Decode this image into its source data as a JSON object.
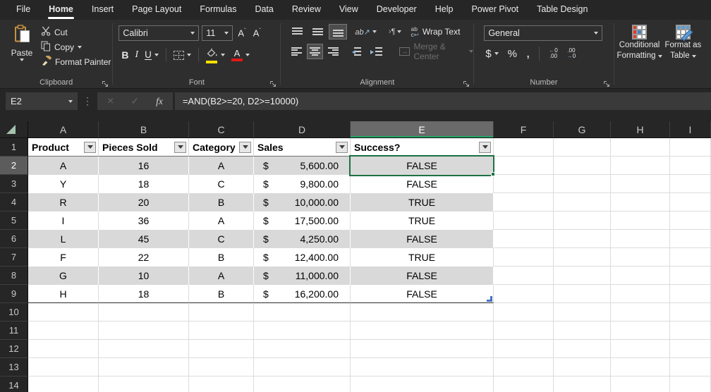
{
  "tabs": {
    "items": [
      "File",
      "Home",
      "Insert",
      "Page Layout",
      "Formulas",
      "Data",
      "Review",
      "View",
      "Developer",
      "Help",
      "Power Pivot",
      "Table Design"
    ],
    "active": "Home"
  },
  "ribbon": {
    "clipboard": {
      "group_label": "Clipboard",
      "paste": "Paste",
      "cut": "Cut",
      "copy": "Copy",
      "format_painter": "Format Painter"
    },
    "font": {
      "group_label": "Font",
      "font_name": "Calibri",
      "font_size": "11",
      "bold": "B",
      "italic": "I",
      "underline": "U"
    },
    "alignment": {
      "group_label": "Alignment",
      "wrap_text": "Wrap Text",
      "merge_center": "Merge & Center"
    },
    "number": {
      "group_label": "Number",
      "number_format": "General",
      "currency": "$",
      "percent": "%",
      "comma": ",",
      "decimals": ".00",
      "zero": "0",
      "arrow_left": "←",
      "arrow_right": "→"
    },
    "styles": {
      "conditional_formatting_line1": "Conditional",
      "conditional_formatting_line2": "Formatting",
      "format_as_table_line1": "Format as",
      "format_as_table_line2": "Table"
    }
  },
  "formula_bar": {
    "name_box": "E2",
    "cancel": "×",
    "enter": "✓",
    "insert_function": "fx",
    "more_dots": "⋮",
    "formula": "=AND(B2>=20, D2>=10000)"
  },
  "icons": {
    "orientation_text": "ab",
    "orientation_arrow": "↗",
    "pilcrow": "¶",
    "direction_mark": "›",
    "wrap_top": "ab",
    "wrap_bottom": "c",
    "return_arrow": "↩",
    "merge_arrow": "↔",
    "size_up_letter": "A",
    "size_up_caret": "ˆ",
    "size_down_letter": "A",
    "size_down_caret": "ˇ",
    "font_color_letter": "A"
  },
  "colors": {
    "accent_green": "#21a366",
    "selection_border_green": "#1e7145",
    "band_gray": "#d9d9d9",
    "fill_color_yellow": "#f7e000",
    "font_color_red": "#e21717",
    "table_handle_blue": "#4472c4"
  },
  "sheet": {
    "column_letters": [
      "A",
      "B",
      "C",
      "D",
      "E",
      "F",
      "G",
      "H",
      "I"
    ],
    "row_numbers": [
      "1",
      "2",
      "3",
      "4",
      "5",
      "6",
      "7",
      "8",
      "9",
      "10",
      "11",
      "12",
      "13",
      "14"
    ],
    "selection": {
      "cell": "E2",
      "column": "E",
      "row": 2
    },
    "table": {
      "headers": [
        "Product",
        "Pieces Sold",
        "Category",
        "Sales",
        "Success?"
      ],
      "rows": [
        {
          "product": "A",
          "pieces_sold": "16",
          "category": "A",
          "currency": "$",
          "sales": "5,600.00",
          "success": "FALSE"
        },
        {
          "product": "Y",
          "pieces_sold": "18",
          "category": "C",
          "currency": "$",
          "sales": "9,800.00",
          "success": "FALSE"
        },
        {
          "product": "R",
          "pieces_sold": "20",
          "category": "B",
          "currency": "$",
          "sales": "10,000.00",
          "success": "TRUE"
        },
        {
          "product": "I",
          "pieces_sold": "36",
          "category": "A",
          "currency": "$",
          "sales": "17,500.00",
          "success": "TRUE"
        },
        {
          "product": "L",
          "pieces_sold": "45",
          "category": "C",
          "currency": "$",
          "sales": "4,250.00",
          "success": "FALSE"
        },
        {
          "product": "F",
          "pieces_sold": "22",
          "category": "B",
          "currency": "$",
          "sales": "12,400.00",
          "success": "TRUE"
        },
        {
          "product": "G",
          "pieces_sold": "10",
          "category": "A",
          "currency": "$",
          "sales": "11,000.00",
          "success": "FALSE"
        },
        {
          "product": "H",
          "pieces_sold": "18",
          "category": "B",
          "currency": "$",
          "sales": "16,200.00",
          "success": "FALSE"
        }
      ]
    }
  }
}
